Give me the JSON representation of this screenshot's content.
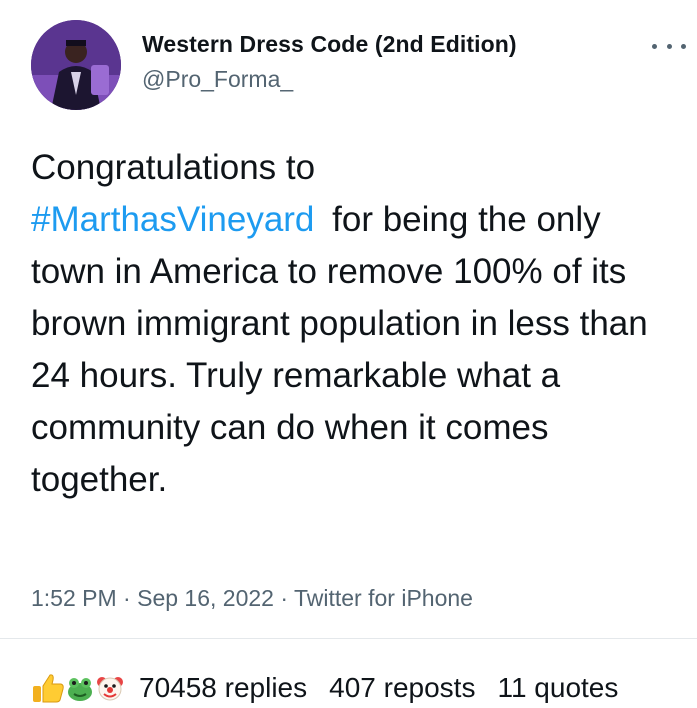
{
  "author": {
    "display_name": "Western Dress Code (2nd Edition)",
    "handle": "@Pro_Forma_"
  },
  "tweet": {
    "text_start": "Congratulations to",
    "hashtag": "#MarthasVineyard",
    "text_rest": "for being the only town in America to remove 100% of its brown immigrant population in less than 24 hours. Truly remarkable what a community can do when it comes together."
  },
  "meta": {
    "time": "1:52 PM",
    "date": "Sep 16, 2022",
    "source": "Twitter for iPhone"
  },
  "stats": {
    "reaction_icons": [
      "thumbs-up",
      "frog",
      "clown-face"
    ],
    "replies": "70458 replies",
    "reposts": "407 reposts",
    "quotes": "11 quotes"
  },
  "colors": {
    "text": "#0f1419",
    "secondary_text": "#536471",
    "link": "#1d9bf0",
    "divider": "#e4e8eb"
  }
}
